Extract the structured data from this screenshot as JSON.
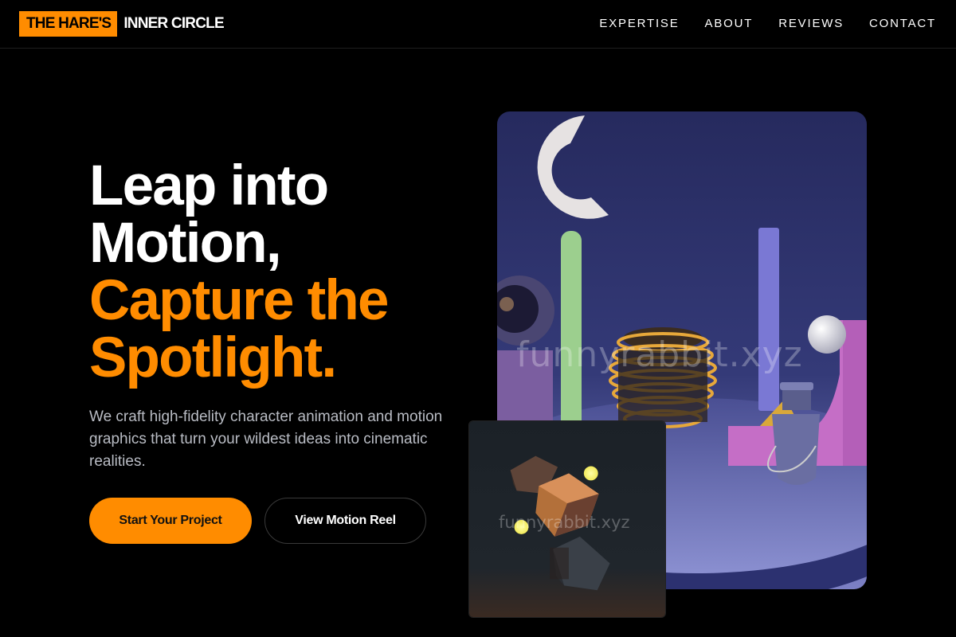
{
  "header": {
    "logo_highlight": "THE HARE'S",
    "logo_text": "INNER CIRCLE",
    "nav": [
      {
        "label": "EXPERTISE"
      },
      {
        "label": "ABOUT"
      },
      {
        "label": "REVIEWS"
      },
      {
        "label": "CONTACT"
      }
    ]
  },
  "hero": {
    "headline_line1": "Leap into",
    "headline_line2": "Motion,",
    "headline_accent1": "Capture the",
    "headline_accent2": "Spotlight.",
    "subtext": "We craft high-fidelity character animation and motion graphics that turn your wildest ideas into cinematic realities.",
    "primary_button": "Start Your Project",
    "secondary_button": "View Motion Reel"
  },
  "media": {
    "main_watermark": "funnyrabbit.xyz",
    "secondary_watermark": "funnyrabbit.xyz"
  },
  "colors": {
    "accent": "#ff8c00",
    "background": "#000000",
    "subtext": "#b9bcc4"
  }
}
